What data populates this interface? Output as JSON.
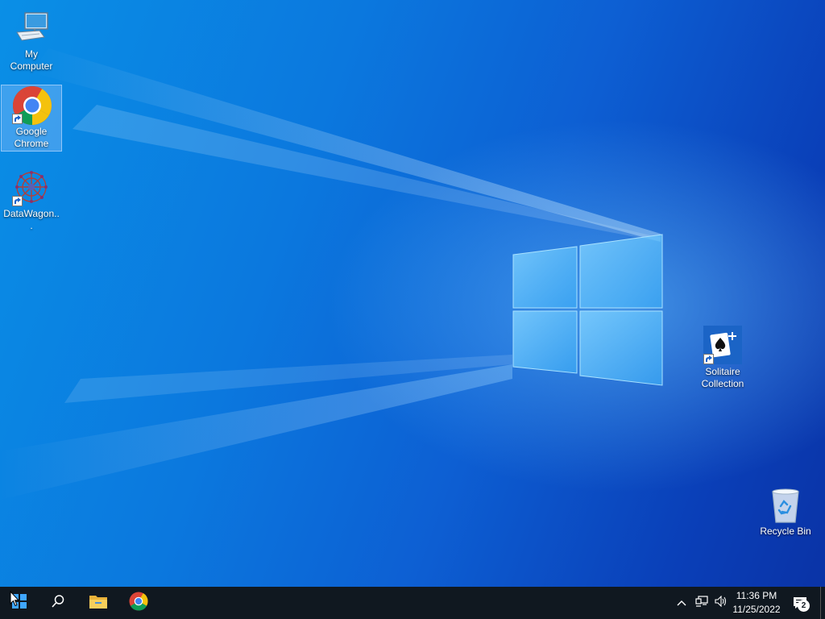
{
  "desktop": {
    "icons": [
      {
        "id": "my-computer",
        "label": "My Computer",
        "icon": "computer-icon"
      },
      {
        "id": "google-chrome",
        "label": "Google Chrome",
        "icon": "chrome-icon",
        "shortcut": true,
        "selected": true
      },
      {
        "id": "datawagon",
        "label": "DataWagon...",
        "icon": "datawagon-icon",
        "shortcut": true
      },
      {
        "id": "solitaire",
        "label": "Solitaire Collection",
        "icon": "solitaire-icon",
        "shortcut": true
      },
      {
        "id": "recycle-bin",
        "label": "Recycle Bin",
        "icon": "recycle-bin-icon"
      }
    ]
  },
  "taskbar": {
    "start_icon": "windows-logo-icon",
    "search_icon": "search-icon",
    "pinned": [
      {
        "name": "File Explorer",
        "icon": "folder-icon"
      },
      {
        "name": "Google Chrome",
        "icon": "chrome-icon"
      }
    ],
    "tray": {
      "overflow_icon": "chevron-up-icon",
      "network_icon": "network-icon",
      "volume_icon": "volume-icon",
      "time": "11:36 PM",
      "date": "11/25/2022",
      "notifications_count": "2",
      "notifications_icon": "action-center-icon"
    }
  },
  "colors": {
    "taskbar_bg": "#101820",
    "desktop_base": "#0b78de",
    "chrome_red": "#db4437",
    "chrome_yellow": "#f4c20d",
    "chrome_green": "#0f9d58",
    "chrome_blue": "#4285f4"
  }
}
